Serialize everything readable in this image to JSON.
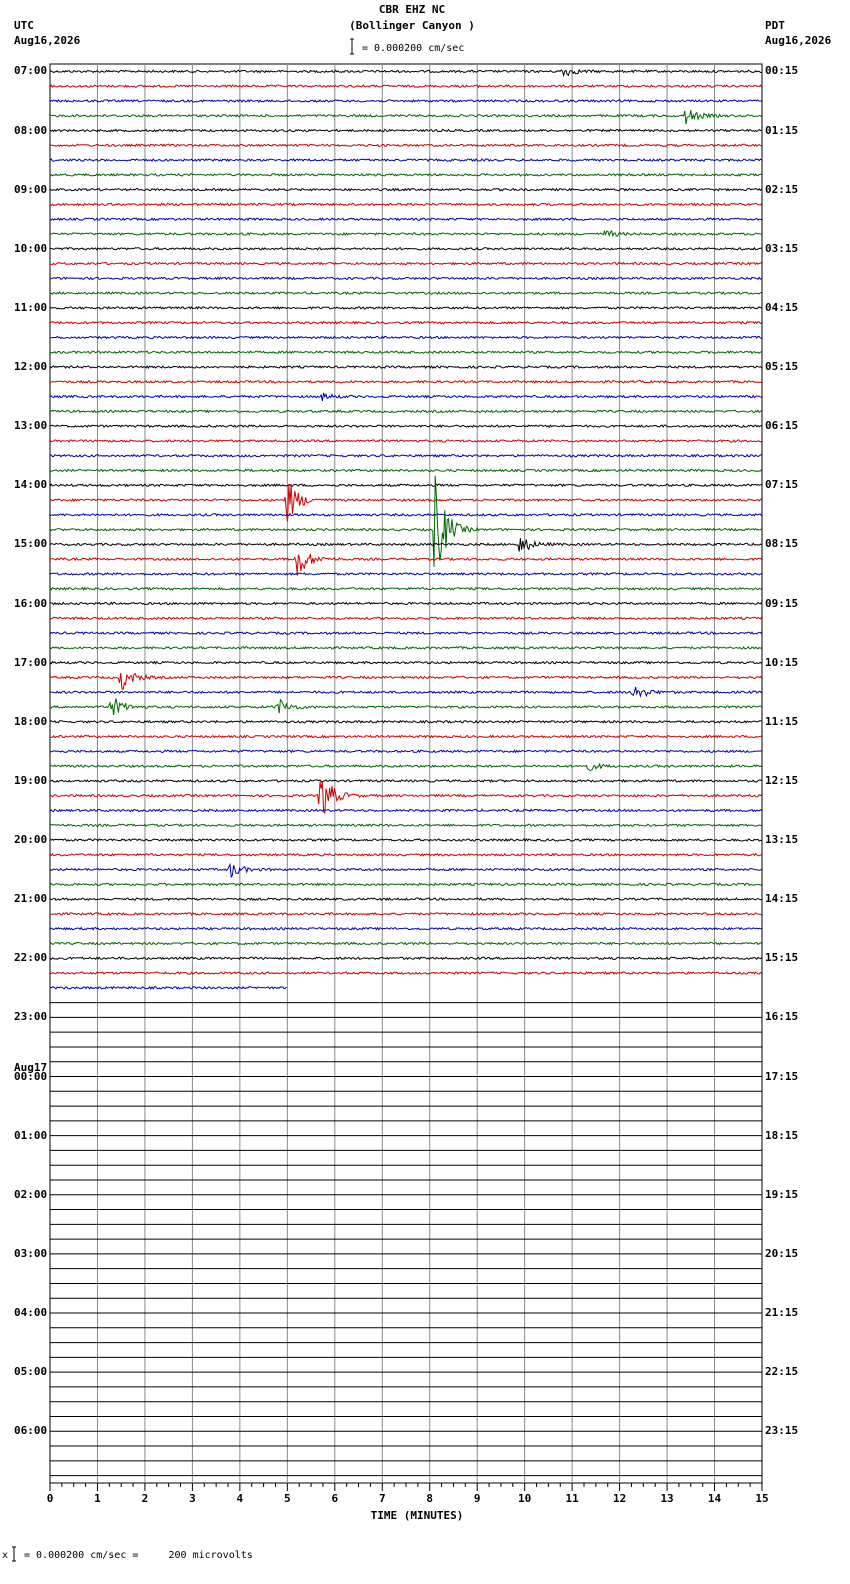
{
  "header": {
    "station": "CBR EHZ NC",
    "location": "(Bollinger Canyon )",
    "scale_text": "= 0.000200 cm/sec",
    "left_tz": "UTC",
    "left_date": "Aug16,2026",
    "right_tz": "PDT",
    "right_date": "Aug16,2026"
  },
  "footer": {
    "scale_text": "= 0.000200 cm/sec =     200 microvolts",
    "prefix": "x"
  },
  "chart_data": {
    "type": "line",
    "title": "CBR EHZ NC (Bollinger Canyon )",
    "xlabel": "TIME (MINUTES)",
    "xlim": [
      0,
      15
    ],
    "x_ticks": [
      "0",
      "1",
      "2",
      "3",
      "4",
      "5",
      "6",
      "7",
      "8",
      "9",
      "10",
      "11",
      "12",
      "13",
      "14",
      "15"
    ],
    "rows_total": 96,
    "rows_per_hour": 4,
    "trace_colors": [
      "#000000",
      "#cc0000",
      "#0000aa",
      "#006600"
    ],
    "day_label": "Aug17",
    "left_hour_labels": [
      "07:00",
      "08:00",
      "09:00",
      "10:00",
      "11:00",
      "12:00",
      "13:00",
      "14:00",
      "15:00",
      "16:00",
      "17:00",
      "18:00",
      "19:00",
      "20:00",
      "21:00",
      "22:00",
      "23:00",
      "00:00",
      "01:00",
      "02:00",
      "03:00",
      "04:00",
      "05:00",
      "06:00"
    ],
    "right_hour_labels": [
      "00:15",
      "01:15",
      "02:15",
      "03:15",
      "04:15",
      "05:15",
      "06:15",
      "07:15",
      "08:15",
      "09:15",
      "10:15",
      "11:15",
      "12:15",
      "13:15",
      "14:15",
      "15:15",
      "16:15",
      "17:15",
      "18:15",
      "19:15",
      "20:15",
      "21:15",
      "22:15",
      "23:15"
    ],
    "recorded_rows": 63,
    "last_row_end_minute": 5.0,
    "events": [
      {
        "row": 0,
        "minute": 10.8,
        "amp": 6
      },
      {
        "row": 3,
        "minute": 13.4,
        "amp": 9
      },
      {
        "row": 11,
        "minute": 11.7,
        "amp": 4
      },
      {
        "row": 22,
        "minute": 5.7,
        "amp": 4
      },
      {
        "row": 29,
        "minute": 5.0,
        "amp": 24
      },
      {
        "row": 31,
        "minute": 8.1,
        "amp": 60
      },
      {
        "row": 32,
        "minute": 9.9,
        "amp": 10
      },
      {
        "row": 33,
        "minute": 5.2,
        "amp": 20
      },
      {
        "row": 41,
        "minute": 1.5,
        "amp": 14
      },
      {
        "row": 42,
        "minute": 12.3,
        "amp": 10
      },
      {
        "row": 43,
        "minute": 1.3,
        "amp": 12
      },
      {
        "row": 43,
        "minute": 4.8,
        "amp": 9
      },
      {
        "row": 47,
        "minute": 11.3,
        "amp": 5
      },
      {
        "row": 49,
        "minute": 5.7,
        "amp": 30
      },
      {
        "row": 54,
        "minute": 3.8,
        "amp": 8
      }
    ]
  }
}
